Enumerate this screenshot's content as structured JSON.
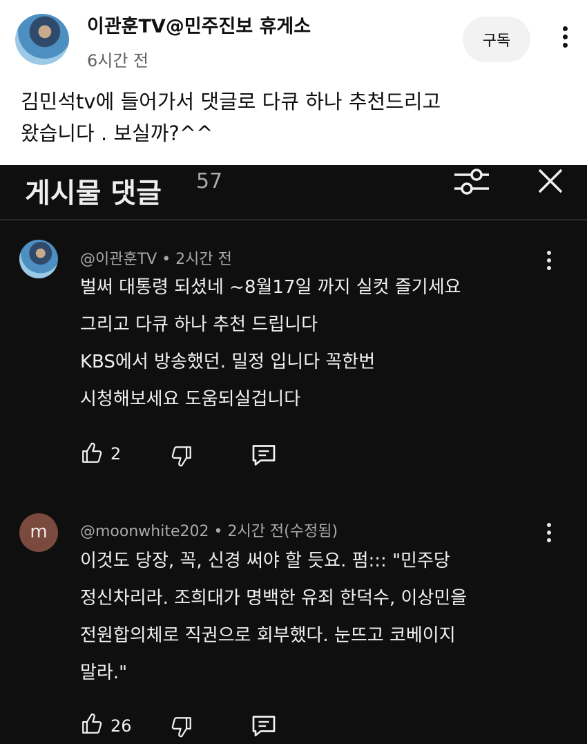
{
  "post": {
    "channel_name": "이관훈TV@민주진보 휴게소",
    "time": "6시간 전",
    "subscribe_label": "구독",
    "body_lines": [
      "김민석tv에  들어가서  댓글로 다큐 하나 추천드리고",
      "왔습니다 .  보실까?^^"
    ]
  },
  "panel": {
    "title": "게시물 댓글",
    "count": "57"
  },
  "comments": [
    {
      "author_meta": "@이관훈TV • 2시간 전",
      "lines": [
        "벌써 대통령 되셨네 ~8월17일 까지 실컷 즐기세요",
        "그리고  다큐 하나 추천 드립니다",
        "KBS에서 방송했던. 밀정 입니다 꼭한번",
        "시청해보세요 도움되실겁니다"
      ],
      "likes": "2"
    },
    {
      "avatar_letter": "m",
      "author_meta": "@moonwhite202 • 2시간 전(수정됨)",
      "lines": [
        "이것도 당장, 꼭, 신경 써야 할 듯요. 펌::: \"민주당",
        "정신차리라. 조희대가 명백한 유죄 한덕수, 이상민을",
        "전원합의체로 직권으로 회부했다. 눈뜨고 코베이지",
        "말라.\""
      ],
      "likes": "26"
    }
  ],
  "colors": {
    "dark_bg": "#0f0f0f",
    "text_light": "#f1f1f1",
    "meta_gray": "#aaaaaa"
  }
}
